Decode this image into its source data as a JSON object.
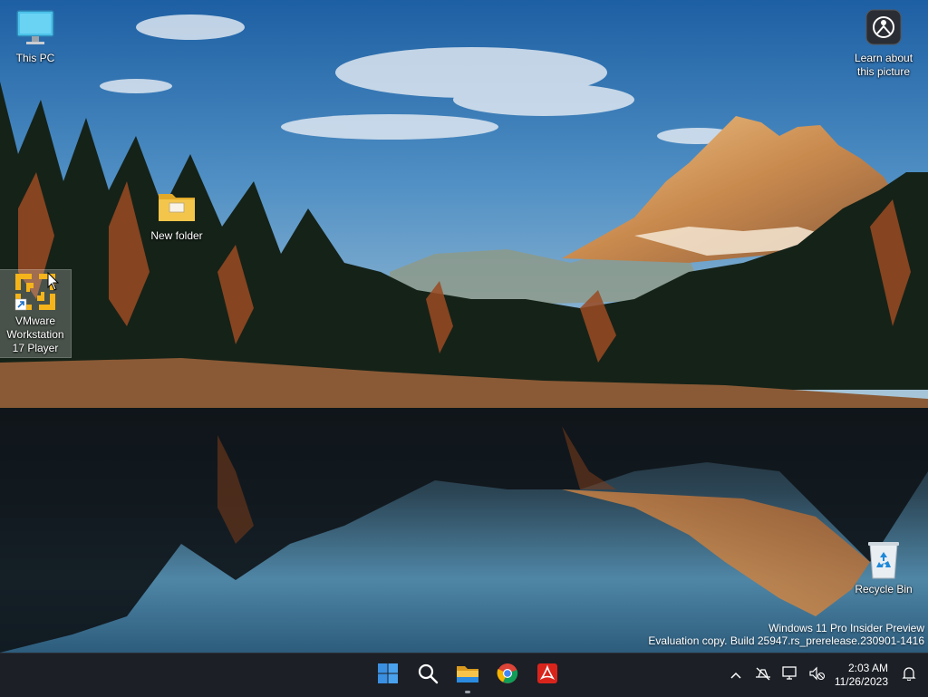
{
  "desktop": {
    "icons": {
      "this_pc": "This PC",
      "new_folder": "New folder",
      "vmware_line1": "VMware",
      "vmware_line2": "Workstation",
      "vmware_line3": "17 Player",
      "recycle_bin": "Recycle Bin",
      "learn_line1": "Learn about",
      "learn_line2": "this picture"
    },
    "watermark": {
      "line1": "Windows 11 Pro Insider Preview",
      "line2": "Evaluation copy. Build 25947.rs_prerelease.230901-1416"
    }
  },
  "taskbar": {
    "pinned": [
      "start-icon",
      "search-icon",
      "file-explorer-icon",
      "chrome-icon",
      "acrobat-icon"
    ],
    "tray_icons": [
      "chevron-up-icon",
      "network-offline-icon",
      "display-icon",
      "volume-muted-icon",
      "notification-bell-icon"
    ],
    "clock": {
      "time": "2:03 AM",
      "date": "11/26/2023"
    }
  },
  "colors": {
    "taskbar_bg": "#1c1f26",
    "start_blue": "#3b8fe0",
    "folder_yellow": "#f3c64b",
    "vmware_orange": "#f4b41a",
    "acrobat_red": "#d9241c"
  }
}
